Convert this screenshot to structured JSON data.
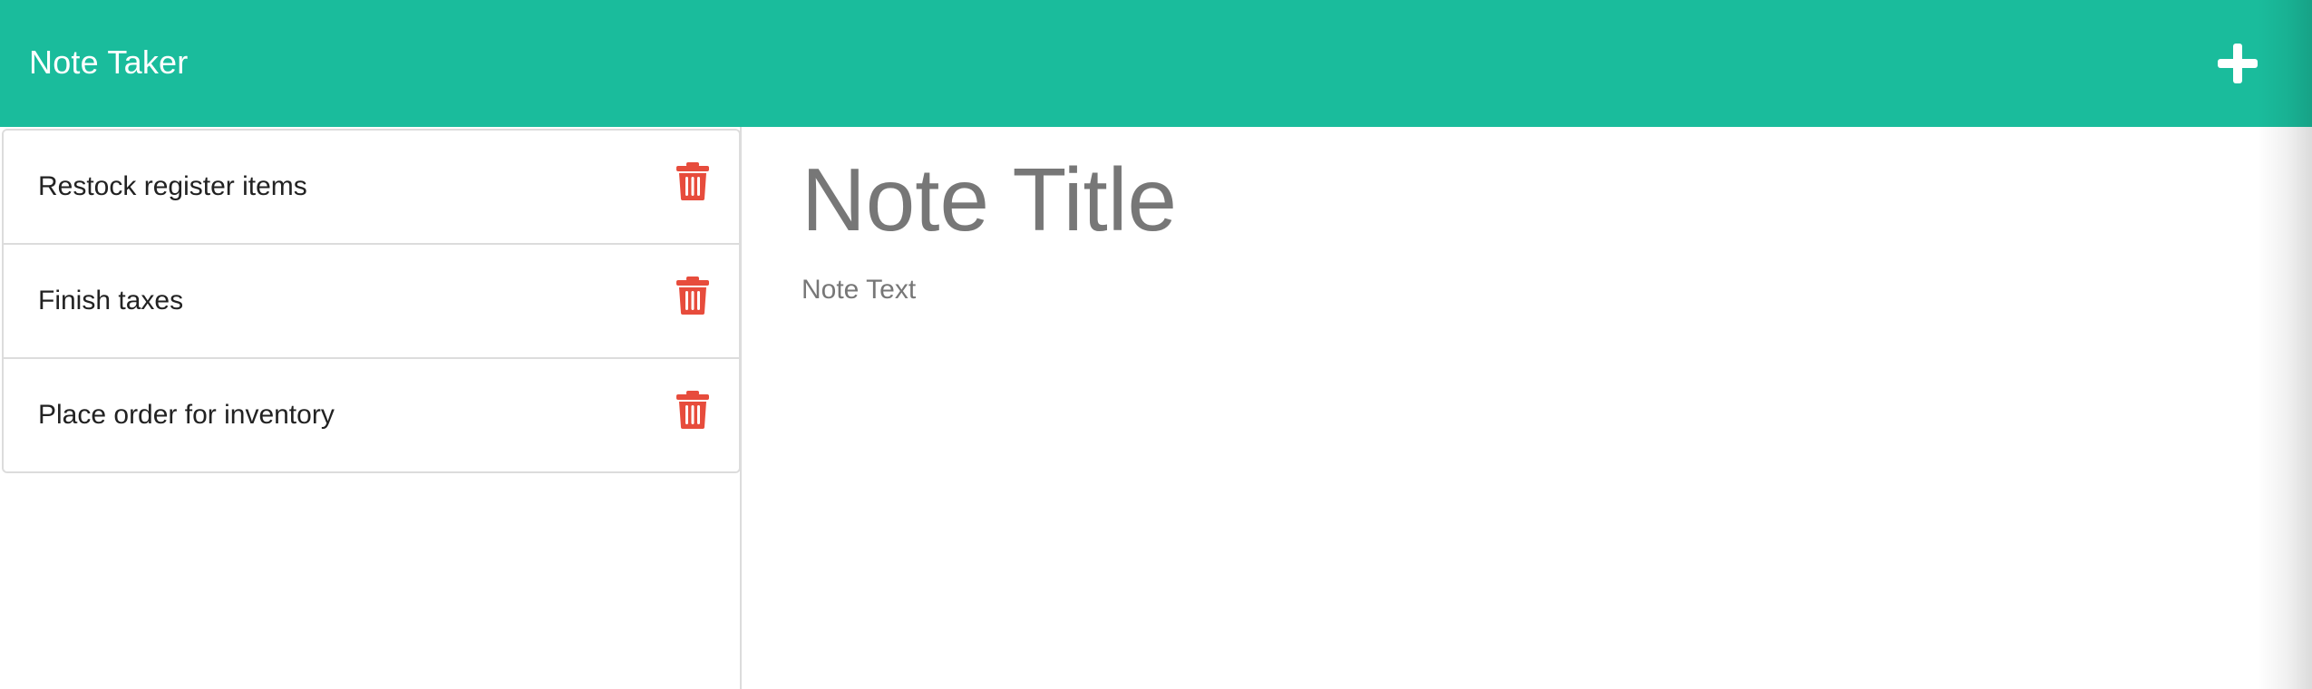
{
  "navbar": {
    "brand": "Note Taker",
    "new_note_icon": "plus-icon"
  },
  "colors": {
    "navbar_bg": "#1abc9c",
    "delete_icon": "#e74c3c",
    "title_text": "#777777"
  },
  "sidebar": {
    "notes": [
      {
        "title": "Restock register items",
        "delete_icon": "trash-icon"
      },
      {
        "title": "Finish taxes",
        "delete_icon": "trash-icon"
      },
      {
        "title": "Place order for inventory",
        "delete_icon": "trash-icon"
      }
    ]
  },
  "editor": {
    "title_placeholder": "Note Title",
    "text_placeholder": "Note Text"
  }
}
